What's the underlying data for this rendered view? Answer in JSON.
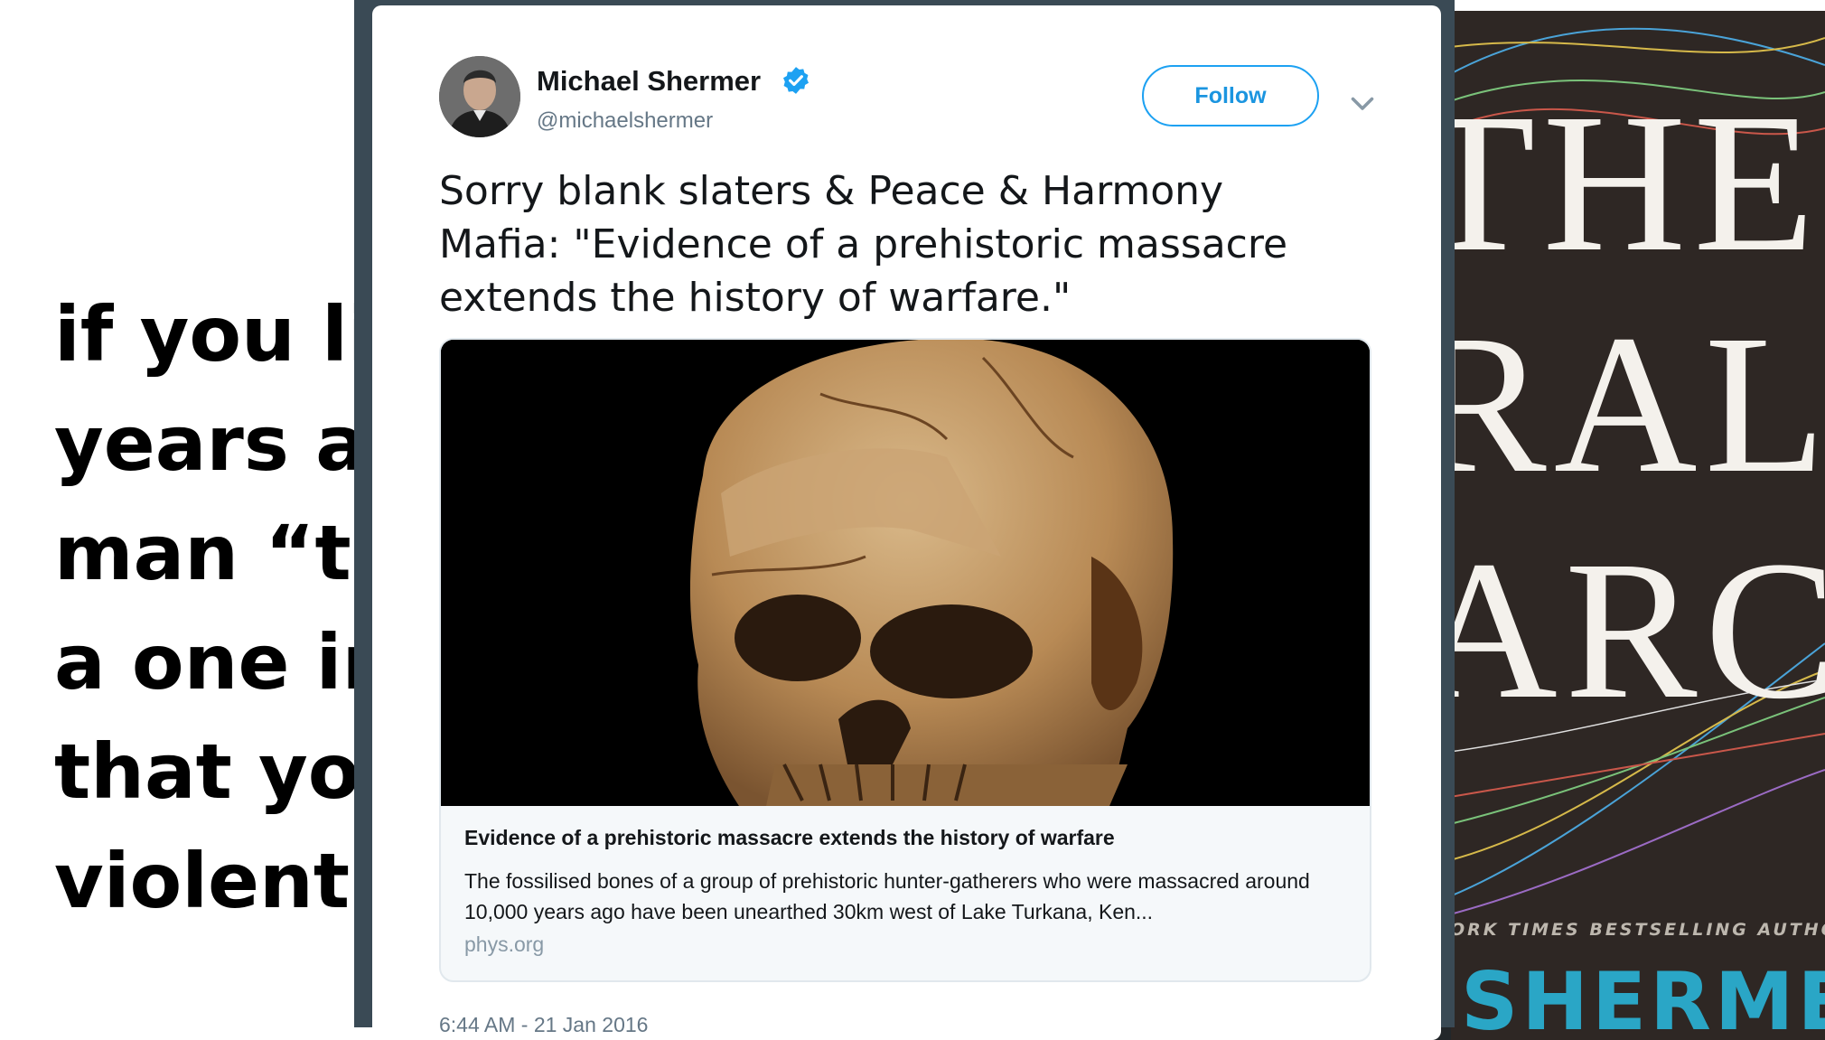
{
  "slide": {
    "lines": [
      "if you liv",
      "years ag",
      "man “th",
      "a one in",
      "that you",
      "violently"
    ]
  },
  "book": {
    "title_lines": [
      "THE",
      "RAL",
      "ARC"
    ],
    "tagline": "ORK TIMES BESTSELLING AUTHOR",
    "author": "SHERMER"
  },
  "tweet": {
    "author_name": "Michael Shermer",
    "handle": "@michaelshermer",
    "follow_label": "Follow",
    "text": "Sorry blank slaters & Peace & Harmony Mafia: \"Evidence of a prehistoric massacre extends the history of warfare.\"",
    "card": {
      "title": "Evidence of a prehistoric massacre extends the history of warfare",
      "description": "The fossilised bones of a group of prehistoric hunter-gatherers who were massacred around 10,000 years ago have been unearthed 30km west of Lake Turkana, Ken...",
      "domain": "phys.org"
    },
    "timestamp": "6:44 AM - 21 Jan 2016"
  },
  "colors": {
    "accent": "#1da1f2",
    "book_bg": "#2e2724",
    "book_author": "#2aa6c6"
  },
  "icons": {
    "verified": "verified-badge-icon",
    "caret": "chevron-down-icon"
  }
}
